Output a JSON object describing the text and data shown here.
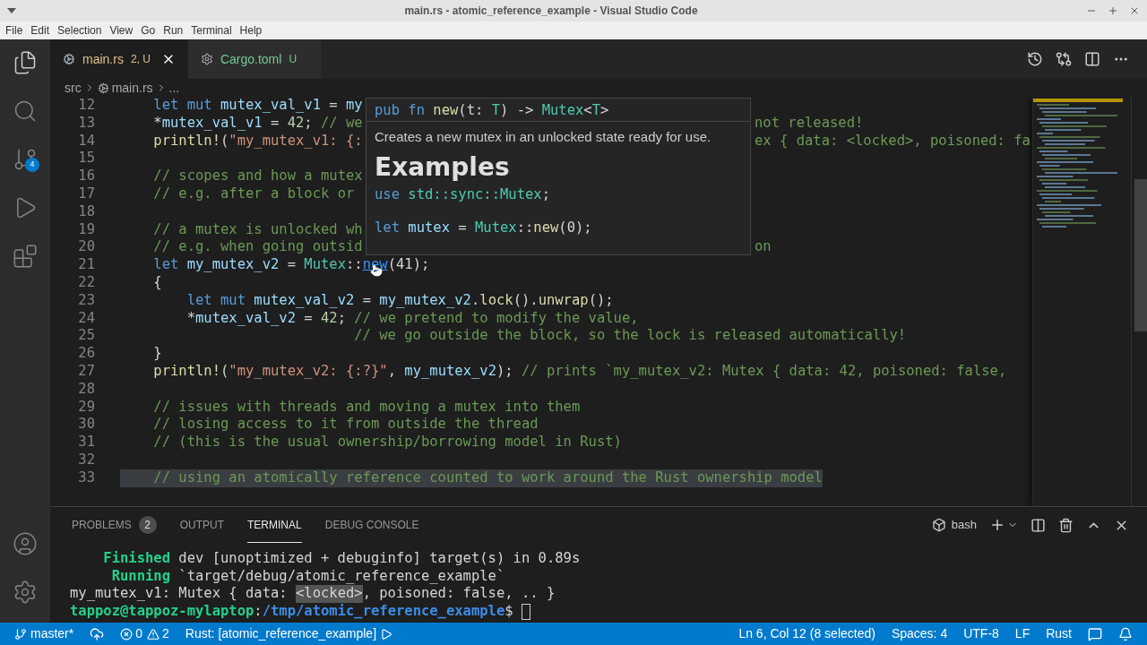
{
  "window": {
    "title": "main.rs - atomic_reference_example - Visual Studio Code"
  },
  "menu": [
    "File",
    "Edit",
    "Selection",
    "View",
    "Go",
    "Run",
    "Terminal",
    "Help"
  ],
  "activity_bar": {
    "source_control_badge": "4"
  },
  "tabs": [
    {
      "label": "main.rs",
      "status": "2, U",
      "kind": "rust",
      "color": "#e2c08d",
      "selected": true
    },
    {
      "label": "Cargo.toml",
      "status": "U",
      "kind": "config",
      "color": "#73c991",
      "selected": false
    }
  ],
  "breadcrumb": [
    {
      "label": "src",
      "kind": "folder"
    },
    {
      "label": "main.rs",
      "kind": "rust"
    },
    {
      "label": "...",
      "kind": "more"
    }
  ],
  "editor": {
    "lines": [
      {
        "number": "12",
        "highlighted": false,
        "segments": [
          {
            "kind": "kw",
            "text": "    let mut "
          },
          {
            "kind": "var",
            "text": "mutex_val_v1"
          },
          {
            "kind": "plain",
            "text": " = "
          },
          {
            "kind": "var",
            "text": "my"
          }
        ]
      },
      {
        "number": "13",
        "highlighted": false,
        "segments": [
          {
            "kind": "plain",
            "text": "    *"
          },
          {
            "kind": "var",
            "text": "mutex_val_v1"
          },
          {
            "kind": "plain",
            "text": " = "
          },
          {
            "kind": "num",
            "text": "42"
          },
          {
            "kind": "plain",
            "text": "; "
          },
          {
            "kind": "com",
            "text": "// we"
          }
        ],
        "after": [
          {
            "kind": "com",
            "text": "not released!"
          }
        ]
      },
      {
        "number": "14",
        "highlighted": false,
        "segments": [
          {
            "kind": "fn",
            "text": "    println!"
          },
          {
            "kind": "plain",
            "text": "("
          },
          {
            "kind": "str",
            "text": "\"my_mutex_v1: {:"
          }
        ],
        "after": [
          {
            "kind": "com",
            "text": "ex { data: <locked>, poisoned: fa"
          }
        ]
      },
      {
        "number": "15",
        "highlighted": false
      },
      {
        "number": "16",
        "highlighted": false,
        "segments": [
          {
            "kind": "com",
            "text": "    // scopes and how a mutex"
          }
        ]
      },
      {
        "number": "17",
        "highlighted": false,
        "segments": [
          {
            "kind": "com",
            "text": "    // e.g. after a block or"
          }
        ]
      },
      {
        "number": "18",
        "highlighted": false
      },
      {
        "number": "19",
        "highlighted": false,
        "segments": [
          {
            "kind": "com",
            "text": "    // a mutex is unlocked wh"
          }
        ]
      },
      {
        "number": "20",
        "highlighted": false,
        "segments": [
          {
            "kind": "com",
            "text": "    // e.g. when going outsid"
          }
        ],
        "after": [
          {
            "kind": "com",
            "text": "on"
          }
        ]
      },
      {
        "number": "21",
        "highlighted": false,
        "segments": [
          {
            "kind": "kw",
            "text": "    let "
          },
          {
            "kind": "var",
            "text": "my_mutex_v2"
          },
          {
            "kind": "plain",
            "text": " = "
          },
          {
            "kind": "type",
            "text": "Mutex"
          },
          {
            "kind": "plain",
            "text": "::"
          },
          {
            "kind": "link",
            "text": "new"
          },
          {
            "kind": "plain",
            "text": "(41);"
          }
        ]
      },
      {
        "number": "22",
        "highlighted": false,
        "segments": [
          {
            "kind": "plain",
            "text": "    {"
          }
        ]
      },
      {
        "number": "23",
        "highlighted": false,
        "segments": [
          {
            "kind": "kw",
            "text": "        let mut "
          },
          {
            "kind": "var",
            "text": "mutex_val_v2"
          },
          {
            "kind": "plain",
            "text": " = "
          },
          {
            "kind": "var",
            "text": "my_mutex_v2"
          },
          {
            "kind": "plain",
            "text": "."
          },
          {
            "kind": "fn",
            "text": "lock"
          },
          {
            "kind": "plain",
            "text": "()."
          },
          {
            "kind": "fn",
            "text": "unwrap"
          },
          {
            "kind": "plain",
            "text": "();"
          }
        ]
      },
      {
        "number": "24",
        "highlighted": false,
        "segments": [
          {
            "kind": "plain",
            "text": "        *"
          },
          {
            "kind": "var",
            "text": "mutex_val_v2"
          },
          {
            "kind": "plain",
            "text": " = "
          },
          {
            "kind": "num",
            "text": "42"
          },
          {
            "kind": "plain",
            "text": "; "
          },
          {
            "kind": "com",
            "text": "// we pretend to modify the value,"
          }
        ]
      },
      {
        "number": "25",
        "highlighted": false,
        "segments": [
          {
            "kind": "com",
            "text": "                            // we go outside the block, so the lock is released automatically!"
          }
        ]
      },
      {
        "number": "26",
        "highlighted": false,
        "segments": [
          {
            "kind": "plain",
            "text": "    }"
          }
        ]
      },
      {
        "number": "27",
        "highlighted": false,
        "segments": [
          {
            "kind": "fn",
            "text": "    println!"
          },
          {
            "kind": "plain",
            "text": "("
          },
          {
            "kind": "str",
            "text": "\"my_mutex_v2: {:?}\""
          },
          {
            "kind": "plain",
            "text": ", "
          },
          {
            "kind": "var",
            "text": "my_mutex_v2"
          },
          {
            "kind": "plain",
            "text": "); "
          },
          {
            "kind": "com",
            "text": "// prints `my_mutex_v2: Mutex { data: 42, poisoned: false,"
          }
        ]
      },
      {
        "number": "28",
        "highlighted": false
      },
      {
        "number": "29",
        "highlighted": false,
        "segments": [
          {
            "kind": "com",
            "text": "    // issues with threads and moving a mutex into them"
          }
        ]
      },
      {
        "number": "30",
        "highlighted": false,
        "segments": [
          {
            "kind": "com",
            "text": "    // losing access to it from outside the thread"
          }
        ]
      },
      {
        "number": "31",
        "highlighted": false,
        "segments": [
          {
            "kind": "com",
            "text": "    // (this is the usual ownership/borrowing model in Rust)"
          }
        ]
      },
      {
        "number": "32",
        "highlighted": false
      },
      {
        "number": "33",
        "highlighted": true,
        "segments": [
          {
            "kind": "com",
            "text": "    // using an atomically reference counted to work around the Rust ownership model"
          }
        ]
      }
    ],
    "hover": {
      "signature": [
        {
          "kind": "kw",
          "text": "pub fn "
        },
        {
          "kind": "fn",
          "text": "new"
        },
        {
          "kind": "plain",
          "text": "(t: "
        },
        {
          "kind": "type",
          "text": "T"
        },
        {
          "kind": "plain",
          "text": ") -> "
        },
        {
          "kind": "type",
          "text": "Mutex"
        },
        {
          "kind": "plain",
          "text": "<"
        },
        {
          "kind": "type",
          "text": "T"
        },
        {
          "kind": "plain",
          "text": ">"
        }
      ],
      "description": "Creates a new mutex in an unlocked state ready for use.",
      "heading": "Examples",
      "example": [
        {
          "segments": [
            {
              "kind": "kw",
              "text": "use "
            },
            {
              "kind": "type",
              "text": "std::sync::Mutex"
            },
            {
              "kind": "plain",
              "text": ";"
            }
          ]
        },
        {
          "segments": [
            {
              "kind": "kw",
              "text": "let "
            },
            {
              "kind": "var",
              "text": "mutex"
            },
            {
              "kind": "plain",
              "text": " = "
            },
            {
              "kind": "type",
              "text": "Mutex"
            },
            {
              "kind": "plain",
              "text": "::"
            },
            {
              "kind": "fn",
              "text": "new"
            },
            {
              "kind": "plain",
              "text": "(0);"
            }
          ]
        }
      ]
    }
  },
  "panel": {
    "tabs": [
      {
        "label": "PROBLEMS",
        "badge": "2",
        "selected": false
      },
      {
        "label": "OUTPUT",
        "selected": false
      },
      {
        "label": "TERMINAL",
        "selected": true
      },
      {
        "label": "DEBUG CONSOLE",
        "selected": false
      }
    ],
    "shell": "bash",
    "terminal": [
      {
        "cursor": false,
        "segments": [
          {
            "kind": "ok",
            "text": "    Finished"
          },
          {
            "kind": "plain",
            "text": " dev [unoptimized + debuginfo] target(s) in 0.89s"
          }
        ]
      },
      {
        "cursor": false,
        "segments": [
          {
            "kind": "ok",
            "text": "     Running"
          },
          {
            "kind": "plain",
            "text": " `target/debug/atomic_reference_example`"
          }
        ]
      },
      {
        "cursor": false,
        "segments": [
          {
            "kind": "plain",
            "text": "my_mutex_v1: Mutex { data: "
          },
          {
            "kind": "match",
            "text": "<locked>"
          },
          {
            "kind": "plain",
            "text": ", poisoned: false, .. }"
          }
        ]
      },
      {
        "cursor": true,
        "segments": [
          {
            "kind": "ok",
            "text": "tappoz@tappoz-mylaptop"
          },
          {
            "kind": "plain",
            "text": ":"
          },
          {
            "kind": "path",
            "text": "/tmp/atomic_reference_example"
          },
          {
            "kind": "plain",
            "text": "$ "
          }
        ]
      }
    ]
  },
  "status_bar": {
    "branch": "master*",
    "errors": "0",
    "warnings": "2",
    "target": "Rust: [atomic_reference_example]",
    "right": [
      "Ln 6, Col 12 (8 selected)",
      "Spaces: 4",
      "UTF-8",
      "LF",
      "Rust"
    ]
  }
}
